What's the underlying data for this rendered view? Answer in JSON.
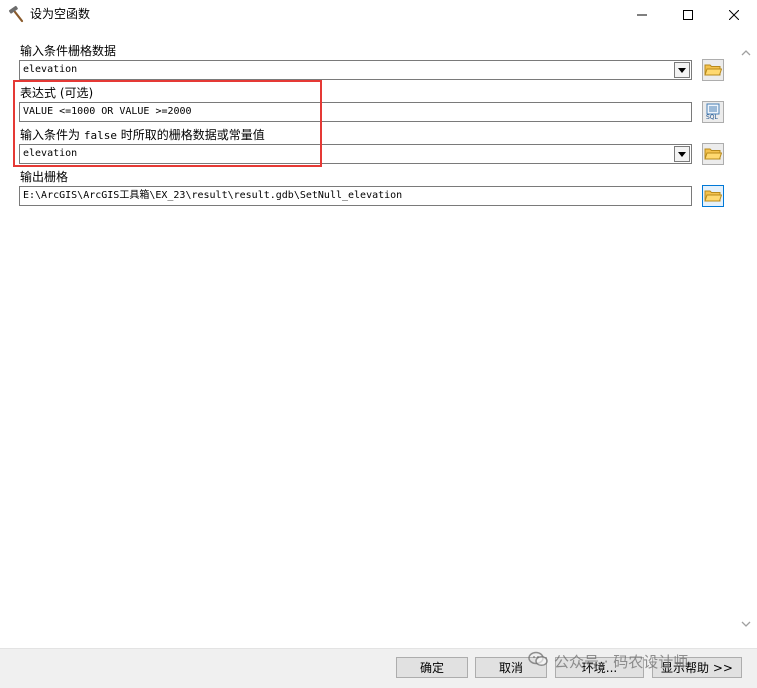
{
  "window": {
    "title": "设为空函数",
    "icon": "hammer-icon",
    "controls": {
      "minimize": "minimize-icon",
      "maximize": "maximize-icon",
      "close": "close-icon"
    }
  },
  "form": {
    "input_raster": {
      "label": "输入条件栅格数据",
      "value": "elevation",
      "button_icon": "open-folder-icon"
    },
    "expression": {
      "label": "表达式 (可选)",
      "value": "VALUE <=1000 OR VALUE >=2000",
      "button_icon": "sql-icon",
      "button_text": "SQL"
    },
    "false_raster": {
      "label_pre": "输入条件为",
      "label_mono": "false",
      "label_post": "时所取的栅格数据或常量值",
      "value": "elevation",
      "button_icon": "open-folder-icon"
    },
    "output_raster": {
      "label": "输出栅格",
      "value": "E:\\ArcGIS\\ArcGIS工具箱\\EX_23\\result\\result.gdb\\SetNull_elevation",
      "button_icon": "open-folder-icon"
    }
  },
  "annotation": {
    "highlight_color": "#e53935"
  },
  "footer": {
    "ok": "确定",
    "cancel": "取消",
    "environments": "环境...",
    "show_help": "显示帮助 >>"
  },
  "watermark": {
    "text": "公众号 · 码农设计师",
    "icon": "wechat-icon"
  },
  "colors": {
    "accent": "#0078d7",
    "button_face": "#e1e1e1",
    "footer_bg": "#f0f0f0"
  }
}
